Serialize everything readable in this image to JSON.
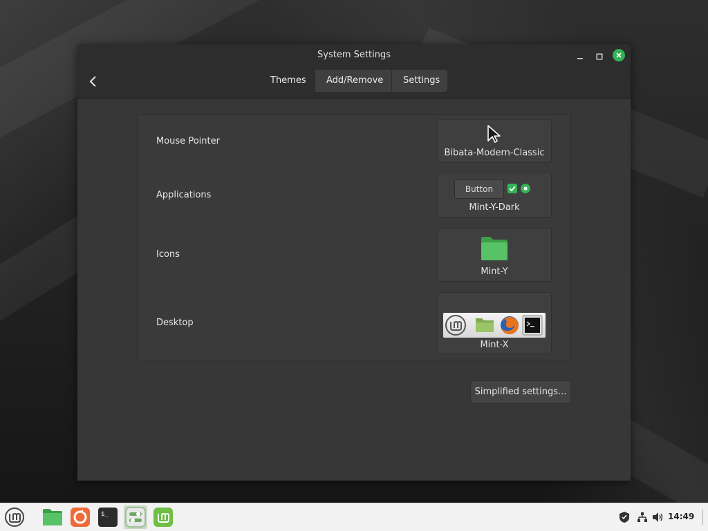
{
  "window": {
    "title": "System Settings",
    "tabs": [
      {
        "label": "Themes",
        "active": true
      },
      {
        "label": "Add/Remove",
        "active": false
      },
      {
        "label": "Settings",
        "active": false
      }
    ]
  },
  "themes": {
    "rows": [
      {
        "label": "Mouse Pointer",
        "value": "Bibata-Modern-Classic"
      },
      {
        "label": "Applications",
        "value": "Mint-Y-Dark",
        "preview_button_label": "Button"
      },
      {
        "label": "Icons",
        "value": "Mint-Y"
      },
      {
        "label": "Desktop",
        "value": "Mint-X"
      }
    ],
    "simplified_button": "Simplified settings..."
  },
  "taskbar": {
    "clock": "14:49",
    "launchers": [
      "mint-menu-icon",
      "files-icon",
      "update-manager-icon",
      "terminal-icon",
      "settings-icon",
      "mintinstall-icon"
    ],
    "tray_icons": [
      "shield-icon",
      "network-icon",
      "volume-icon",
      "show-desktop-icon"
    ]
  },
  "colors": {
    "accent": "#35b257",
    "window_bg": "#373737",
    "titlebar_bg": "#2d2d2d"
  }
}
